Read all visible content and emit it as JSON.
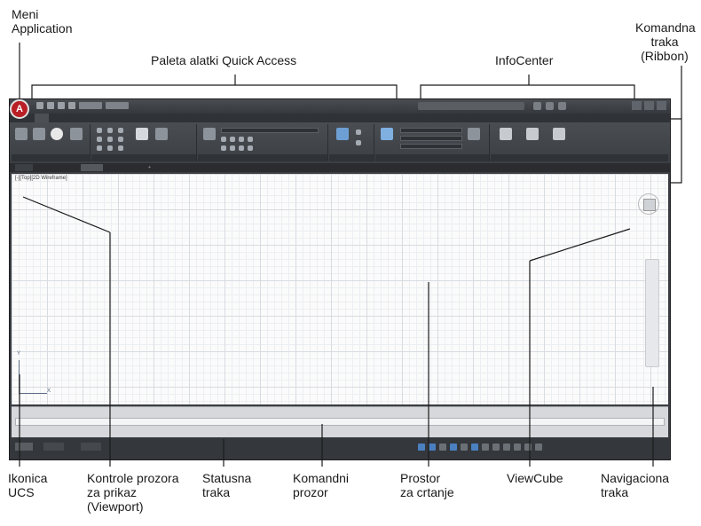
{
  "callouts": {
    "application_menu": [
      "Meni",
      "Application"
    ],
    "quick_access": "Paleta alatki Quick Access",
    "infocenter": "InfoCenter",
    "ribbon": [
      "Komandna",
      "traka",
      "(Ribbon)"
    ],
    "ucs_icon": [
      "Ikonica",
      "UCS"
    ],
    "viewport_controls": [
      "Kontrole prozora",
      "za prikaz",
      "(Viewport)"
    ],
    "status_bar": [
      "Statusna",
      "traka"
    ],
    "command_window": [
      "Komandni",
      "prozor"
    ],
    "drawing_area": [
      "Prostor",
      "za crtanje"
    ],
    "viewcube": "ViewCube",
    "navigation_bar": [
      "Navigaciona",
      "traka"
    ]
  },
  "app": {
    "app_button_letter": "A",
    "viewport_controls_label": "[-][Top][2D Wireframe]",
    "ucs_x": "X",
    "ucs_y": "Y"
  },
  "colors": {
    "app_button": "#b91f25",
    "ribbon_bg": "#3b3f44",
    "drawing_bg": "#fbfbfb",
    "status_active": "#4a7fc0"
  },
  "icons": [
    "application-menu-icon",
    "save-icon",
    "undo-icon",
    "redo-icon",
    "search-icon",
    "help-icon",
    "minimize-icon",
    "maximize-icon",
    "close-icon",
    "line-icon",
    "circle-icon",
    "text-icon",
    "layer-icon",
    "viewcube-icon",
    "grid-icon",
    "snap-icon"
  ]
}
